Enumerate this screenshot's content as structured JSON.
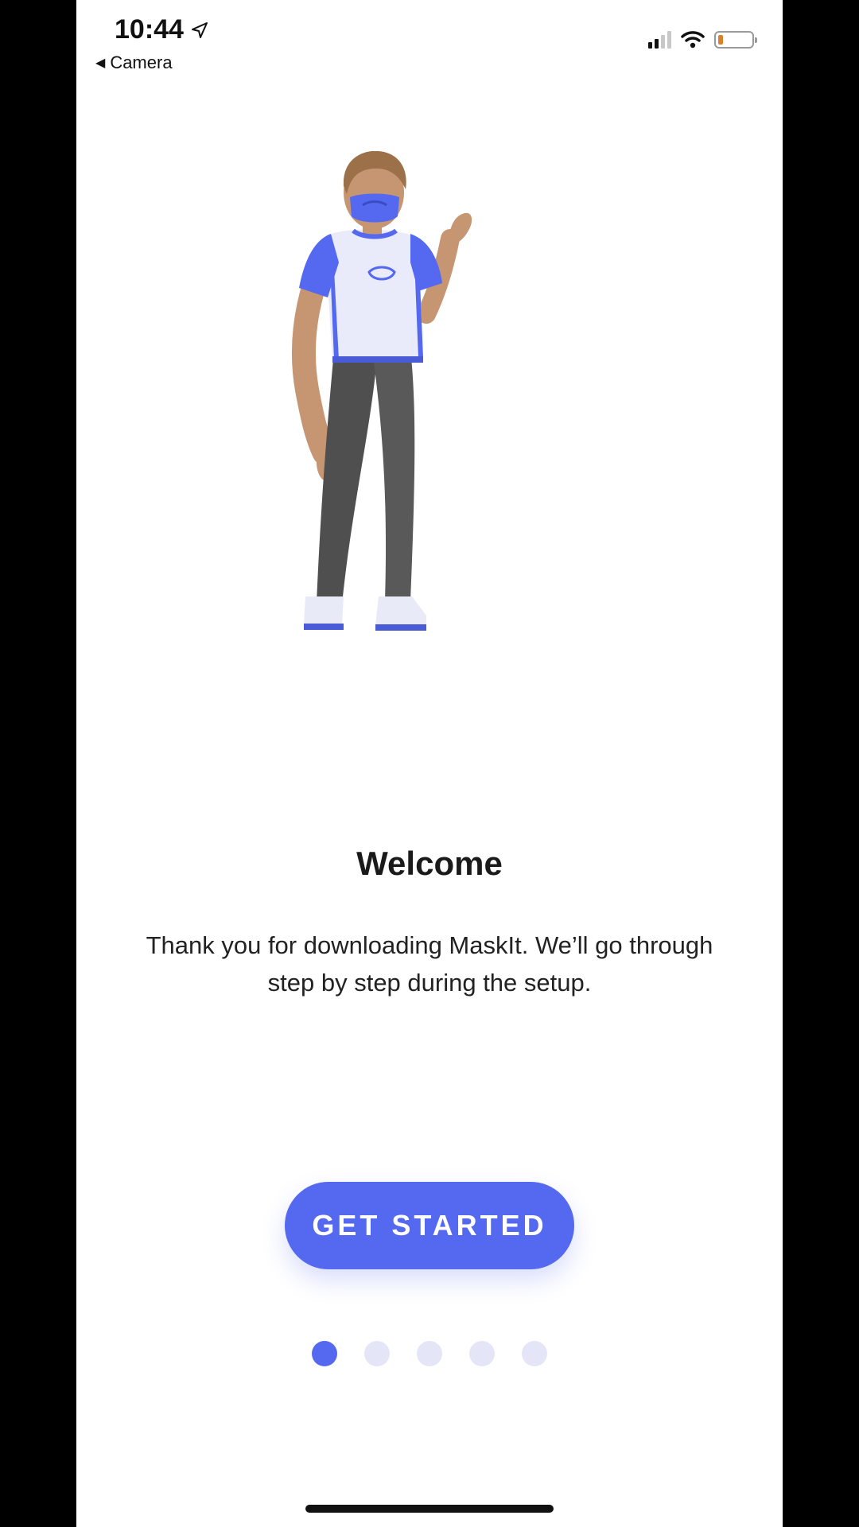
{
  "status_bar": {
    "time": "10:44",
    "back_label": "Camera",
    "icons": [
      "location-arrow-icon",
      "signal-icon",
      "wifi-icon",
      "battery-icon"
    ]
  },
  "onboarding": {
    "title": "Welcome",
    "subtitle": "Thank you for downloading MaskIt. We’ll go through step by step during the setup.",
    "cta_label": "GET STARTED",
    "pager": {
      "total": 5,
      "current": 1
    }
  },
  "colors": {
    "accent": "#5468f0",
    "dot_inactive": "#e4e6f8",
    "text": "#1a1a1a"
  }
}
